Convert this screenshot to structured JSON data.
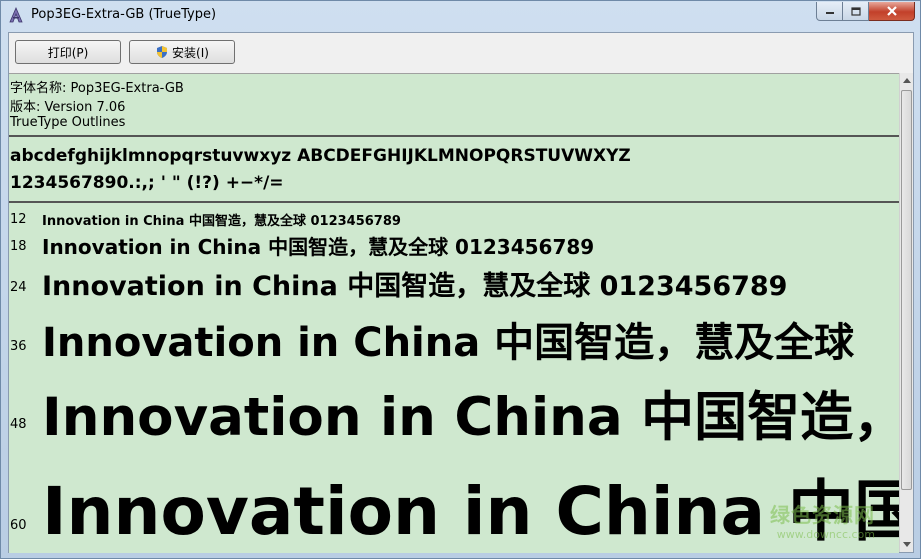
{
  "window": {
    "title": "Pop3EG-Extra-GB (TrueType)"
  },
  "toolbar": {
    "print_label": "打印(P)",
    "install_label": "安装(I)"
  },
  "font_info": {
    "name_line": "字体名称: Pop3EG-Extra-GB",
    "version_line": "版本: Version 7.06",
    "outline_line": "TrueType Outlines"
  },
  "charset": {
    "letters": "abcdefghijklmnopqrstuvwxyz ABCDEFGHIJKLMNOPQRSTUVWXYZ",
    "digits": "1234567890.:,; ' \" (!?) +−*/="
  },
  "samples": [
    {
      "size": "12",
      "text": "Innovation in China 中国智造，慧及全球 0123456789"
    },
    {
      "size": "18",
      "text": "Innovation in China 中国智造，慧及全球 0123456789"
    },
    {
      "size": "24",
      "text": "Innovation in China 中国智造，慧及全球 0123456789"
    },
    {
      "size": "36",
      "text": "Innovation in China 中国智造，慧及全球"
    },
    {
      "size": "48",
      "text": "Innovation in China 中国智造，"
    },
    {
      "size": "60",
      "text": "Innovation in China 中国智"
    }
  ],
  "watermark": {
    "main": "绿色资源网",
    "sub": "www.downcc.com"
  },
  "colors": {
    "preview_background": "#cfe8cf",
    "close_button": "#c2402a"
  },
  "icons": {
    "app": "font-viewer-icon",
    "install": "uac-shield-icon"
  }
}
